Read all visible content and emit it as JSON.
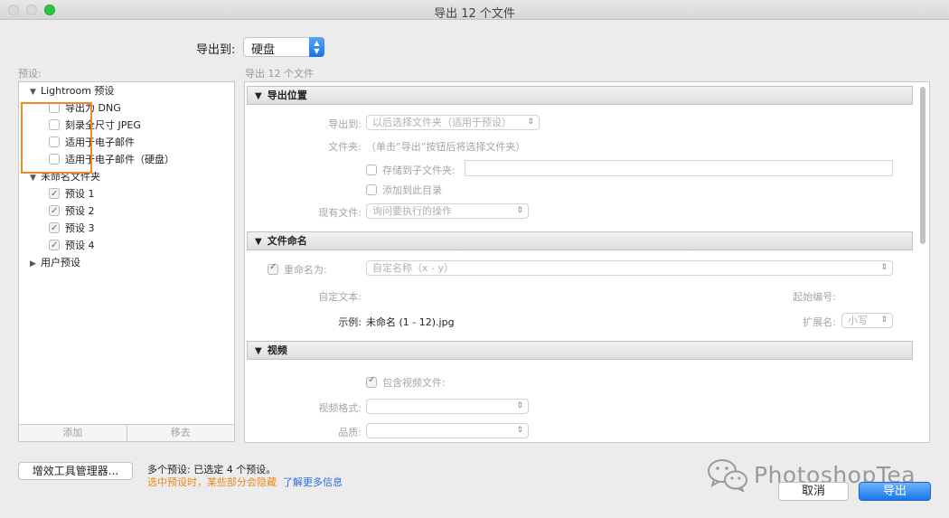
{
  "window": {
    "title": "导出 12 个文件"
  },
  "export_to": {
    "label": "导出到:",
    "value": "硬盘"
  },
  "presets": {
    "label": "预设:",
    "groups": [
      {
        "name": "Lightroom 预设",
        "expanded": true,
        "items": [
          {
            "label": "导出为 DNG",
            "checked": false
          },
          {
            "label": "刻录全尺寸 JPEG",
            "checked": false
          },
          {
            "label": "适用于电子邮件",
            "checked": false
          },
          {
            "label": "适用于电子邮件（硬盘）",
            "checked": false
          }
        ]
      },
      {
        "name": "未命名文件夹",
        "expanded": true,
        "items": [
          {
            "label": "预设 1",
            "checked": true
          },
          {
            "label": "预设 2",
            "checked": true
          },
          {
            "label": "预设 3",
            "checked": true
          },
          {
            "label": "预设 4",
            "checked": true
          }
        ]
      },
      {
        "name": "用户预设",
        "expanded": false,
        "items": []
      }
    ],
    "add_label": "添加",
    "remove_label": "移去"
  },
  "files_count": "导出 12 个文件",
  "sections": {
    "location": {
      "title": "导出位置",
      "export_to_label": "导出到:",
      "export_to_value": "以后选择文件夹（适用于预设）",
      "folder_label": "文件夹:",
      "folder_value": "（单击“导出”按钮后将选择文件夹）",
      "subfolder_label": "存储到子文件夹:",
      "add_catalog_label": "添加到此目录",
      "existing_label": "现有文件:",
      "existing_value": "询问要执行的操作"
    },
    "naming": {
      "title": "文件命名",
      "rename_label": "重命名为:",
      "rename_value": "自定名称（x - y）",
      "custom_text_label": "自定文本:",
      "start_number_label": "起始编号:",
      "example_label": "示例:",
      "example_value": "未命名 (1 - 12).jpg",
      "extension_label": "扩展名:",
      "extension_value": "小写"
    },
    "video": {
      "title": "视频",
      "include_label": "包含视频文件:",
      "format_label": "视频格式:",
      "quality_label": "品质:"
    }
  },
  "bottom": {
    "plugin_manager": "增效工具管理器...",
    "multi_presets": "多个预设: 已选定 4 个预设。",
    "warning": "选中预设时，某些部分会隐藏",
    "more_info": "了解更多信息",
    "cancel": "取消",
    "export": "导出"
  },
  "watermark": {
    "text": "PhotoshopTea"
  },
  "colors": {
    "accent": "#1b76ec",
    "highlight": "#f08a24",
    "warning": "#e98b1f",
    "link": "#2a6fdc"
  }
}
